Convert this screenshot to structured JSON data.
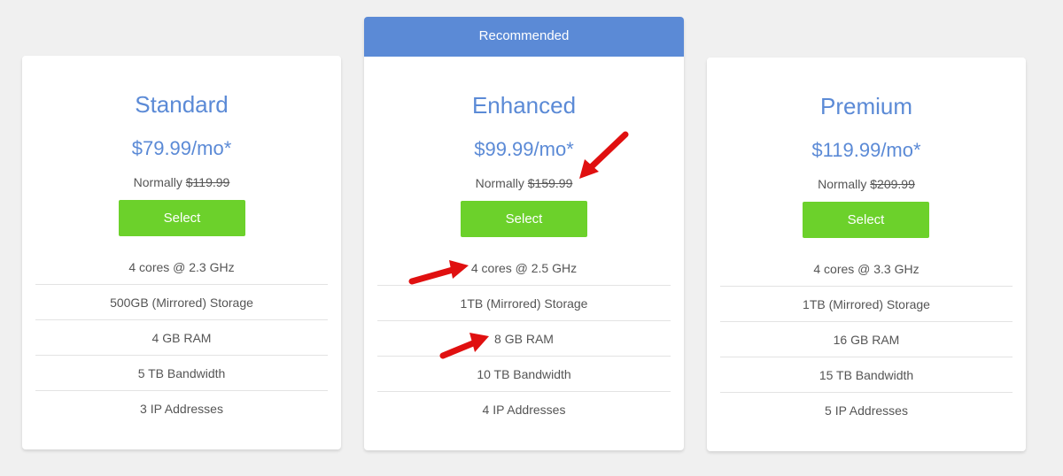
{
  "plans": [
    {
      "ribbon": "",
      "name": "Standard",
      "price": "$79.99/mo*",
      "normally_label": "Normally",
      "normally_price": "$119.99",
      "button": "Select",
      "features": [
        "4 cores @ 2.3 GHz",
        "500GB (Mirrored) Storage",
        "4 GB RAM",
        "5 TB Bandwidth",
        "3 IP Addresses"
      ]
    },
    {
      "ribbon": "Recommended",
      "name": "Enhanced",
      "price": "$99.99/mo*",
      "normally_label": "Normally",
      "normally_price": "$159.99",
      "button": "Select",
      "features": [
        "4 cores @ 2.5 GHz",
        "1TB (Mirrored) Storage",
        "8 GB RAM",
        "10 TB Bandwidth",
        "4 IP Addresses"
      ]
    },
    {
      "ribbon": "",
      "name": "Premium",
      "price": "$119.99/mo*",
      "normally_label": "Normally",
      "normally_price": "$209.99",
      "button": "Select",
      "features": [
        "4 cores @ 3.3 GHz",
        "1TB (Mirrored) Storage",
        "16 GB RAM",
        "15 TB Bandwidth",
        "5 IP Addresses"
      ]
    }
  ],
  "colors": {
    "accent": "#5b8ad6",
    "button": "#6cd12b",
    "annotation_arrow": "#e01010"
  },
  "annotations": {
    "arrow_icon": "red-arrow-icon"
  }
}
